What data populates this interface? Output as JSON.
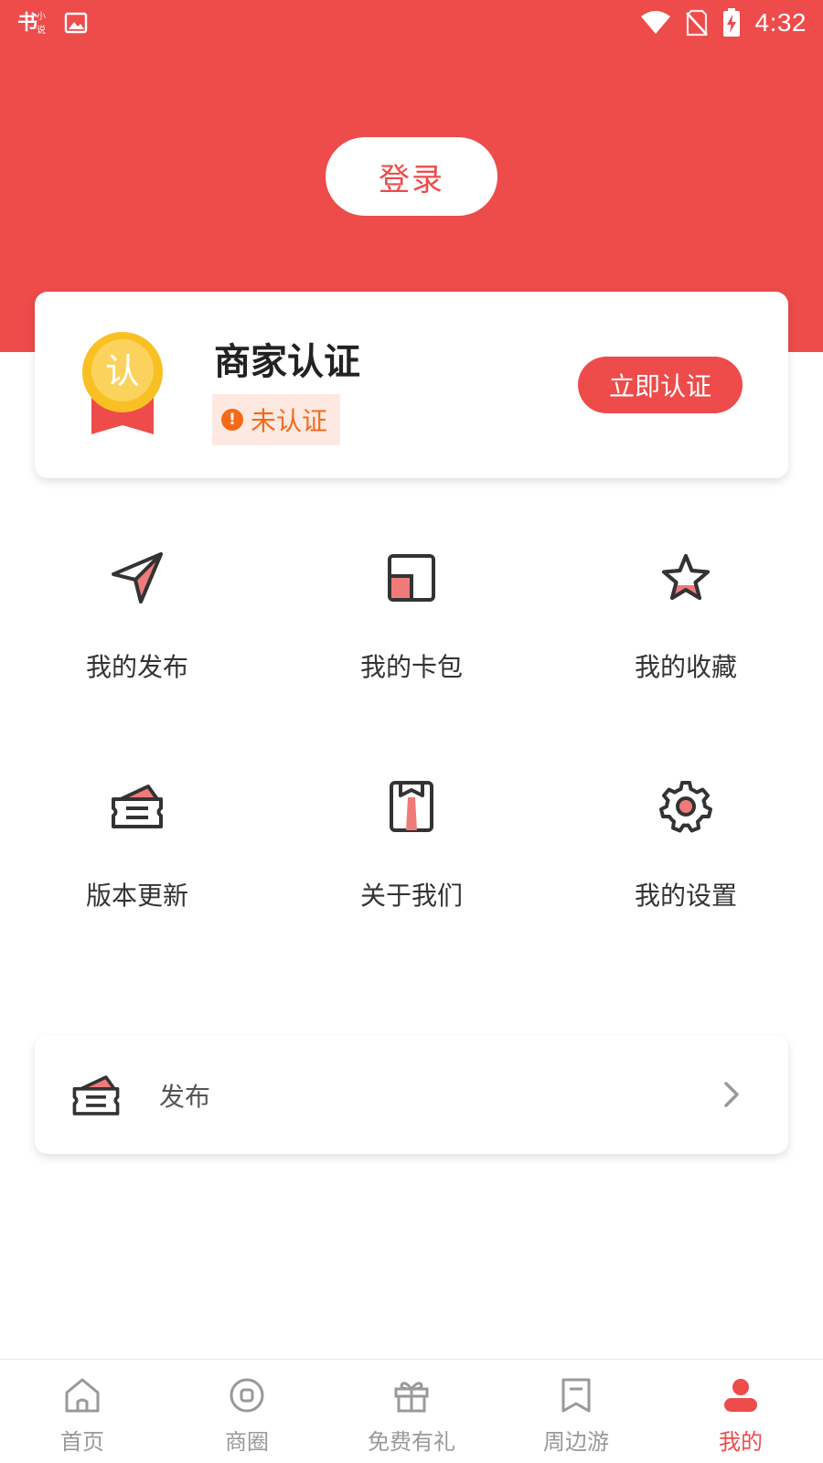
{
  "status_bar": {
    "time": "4:32",
    "icons": [
      "app-logo-icon",
      "image-icon",
      "wifi-icon",
      "no-sim-icon",
      "battery-charging-icon"
    ],
    "app_logo_text": "书小说"
  },
  "header": {
    "login_label": "登录",
    "background_color": "#ee4b4b"
  },
  "cert_card": {
    "title": "商家认证",
    "status_text": "未认证",
    "button_label": "立即认证",
    "medal_char": "认",
    "medal_icon": "medal-icon",
    "status_icon": "warning-icon"
  },
  "menu": {
    "items": [
      {
        "label": "我的发布",
        "icon": "send-icon"
      },
      {
        "label": "我的卡包",
        "icon": "card-wallet-icon"
      },
      {
        "label": "我的收藏",
        "icon": "star-icon"
      },
      {
        "label": "版本更新",
        "icon": "ticket-icon"
      },
      {
        "label": "关于我们",
        "icon": "about-icon"
      },
      {
        "label": "我的设置",
        "icon": "settings-icon"
      }
    ]
  },
  "publish_row": {
    "label": "发布",
    "icon": "ticket-icon",
    "trailing_icon": "chevron-right-icon"
  },
  "bottom_nav": {
    "items": [
      {
        "label": "首页",
        "icon": "home-icon"
      },
      {
        "label": "商圈",
        "icon": "circle-icon"
      },
      {
        "label": "免费有礼",
        "icon": "gift-icon"
      },
      {
        "label": "周边游",
        "icon": "bookmark-icon"
      },
      {
        "label": "我的",
        "icon": "user-icon"
      }
    ],
    "active_label": "我的"
  },
  "colors": {
    "accent": "#ee4b4b",
    "warning": "#f46a19",
    "warning_bg": "#fde9e2",
    "icon_fill": "#f07a7a",
    "icon_stroke": "#333333",
    "nav_inactive": "#999999"
  }
}
